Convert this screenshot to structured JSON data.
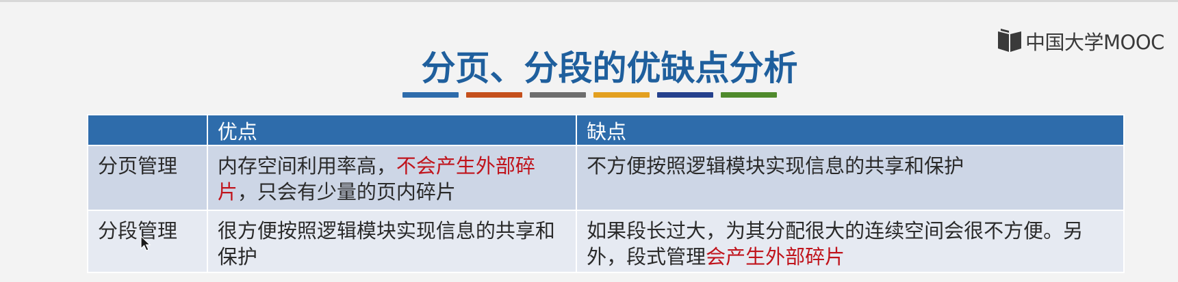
{
  "slide": {
    "title": "分页、分段的优缺点分析",
    "logo_text": "中国大学MOOC",
    "accent_bars": [
      "#2e6cab",
      "#c5501c",
      "#6d6d6d",
      "#e3a020",
      "#25418d",
      "#4f8a2c"
    ]
  },
  "table": {
    "headers": [
      "",
      "优点",
      "缺点"
    ],
    "rows": [
      {
        "label": "分页管理",
        "pros": {
          "plain_before": "内存空间利用率高，",
          "red": "不会产生外部碎片",
          "plain_after": "，只会有少量的页内碎片"
        },
        "cons": {
          "plain_before": "不方便按照逻辑模块实现信息的共享和保护",
          "red": "",
          "plain_after": ""
        }
      },
      {
        "label": "分段管理",
        "pros": {
          "plain_before": "很方便按照逻辑模块实现信息的共享和保护",
          "red": "",
          "plain_after": ""
        },
        "cons": {
          "plain_before": "如果段长过大，为其分配很大的连续空间会很不方便。另外，段式管理",
          "red": "会产生外部碎片",
          "plain_after": ""
        }
      }
    ]
  }
}
